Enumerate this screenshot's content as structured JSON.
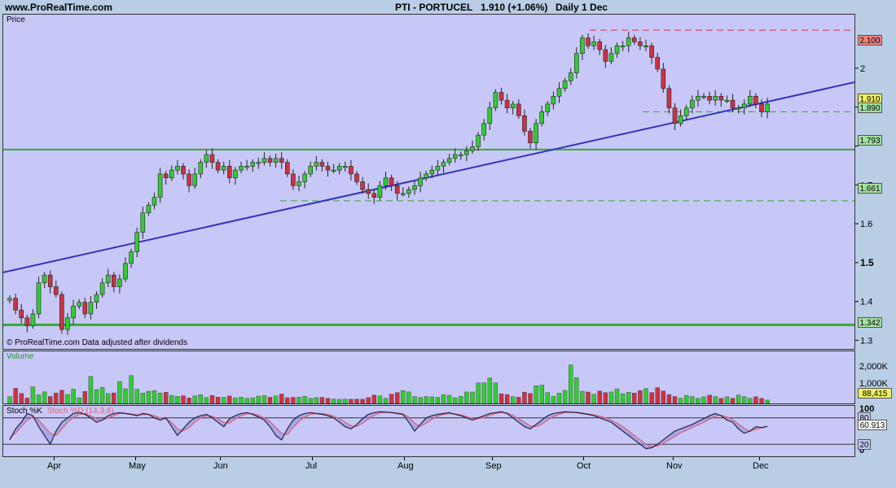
{
  "header": {
    "site": "www.ProRealTime.com",
    "symbol": "PTI - PORTUCEL",
    "quote": "1.910 (+1.06%)",
    "period": "Daily  1 Dec"
  },
  "price_panel": {
    "label": "Price",
    "footer": "© ProRealTime.com  Data adjusted after dividends",
    "tags": [
      {
        "text": "2.100",
        "bg": "#f08080"
      },
      {
        "text": "1.910",
        "bg": "#f0f060"
      },
      {
        "text": "1.890",
        "bg": "#a0e0a0"
      },
      {
        "text": "1.793",
        "bg": "#a0e0a0"
      },
      {
        "text": "1.661",
        "bg": "#a0e0a0"
      },
      {
        "text": "1.342",
        "bg": "#a0e0a0"
      }
    ]
  },
  "volume_panel": {
    "label": "Volume",
    "axis": [
      "2,000K",
      "1,000K"
    ],
    "tag": "88,415"
  },
  "stoch_panel": {
    "label_k": "Stoch %K",
    "label_d": "Stoch %D (14,3,6)",
    "axis_top": "100",
    "axis_bottom": "0",
    "tags": [
      {
        "text": "80"
      },
      {
        "text": "60.913"
      },
      {
        "text": "20"
      }
    ]
  },
  "colors": {
    "up": "#33cc33",
    "down": "#cc3344",
    "trend": "#3333bb",
    "support": "#33aa33",
    "resistance": "#cc3344",
    "stoch_d": "#e06070"
  },
  "chart_data": {
    "type": "candlestick",
    "title": "PTI - PORTUCEL",
    "ylabel": "Price",
    "ylim": [
      1.28,
      2.14
    ],
    "yticks": [
      1.3,
      1.4,
      1.5,
      1.6,
      1.7,
      1.8,
      1.9,
      2.0
    ],
    "ytick_labels": [
      "1.3",
      "1.4",
      "1.5",
      "1.6",
      "1.7",
      "",
      "1.9",
      "2"
    ],
    "months": [
      "Apr",
      "May",
      "Jun",
      "Jul",
      "Aug",
      "Sep",
      "Oct",
      "Nov",
      "Dec"
    ],
    "close_path": [
      1.41,
      1.38,
      1.36,
      1.34,
      1.37,
      1.45,
      1.47,
      1.44,
      1.42,
      1.33,
      1.36,
      1.39,
      1.4,
      1.37,
      1.4,
      1.42,
      1.45,
      1.47,
      1.44,
      1.46,
      1.5,
      1.53,
      1.58,
      1.63,
      1.65,
      1.67,
      1.73,
      1.72,
      1.74,
      1.75,
      1.73,
      1.7,
      1.73,
      1.76,
      1.78,
      1.76,
      1.74,
      1.75,
      1.72,
      1.74,
      1.75,
      1.75,
      1.76,
      1.76,
      1.77,
      1.76,
      1.77,
      1.76,
      1.73,
      1.7,
      1.71,
      1.73,
      1.75,
      1.76,
      1.75,
      1.74,
      1.74,
      1.75,
      1.75,
      1.73,
      1.71,
      1.69,
      1.68,
      1.67,
      1.7,
      1.72,
      1.7,
      1.68,
      1.68,
      1.69,
      1.7,
      1.72,
      1.73,
      1.74,
      1.75,
      1.76,
      1.77,
      1.78,
      1.78,
      1.79,
      1.8,
      1.83,
      1.86,
      1.9,
      1.94,
      1.92,
      1.9,
      1.91,
      1.88,
      1.84,
      1.81,
      1.86,
      1.89,
      1.91,
      1.93,
      1.95,
      1.97,
      1.99,
      2.04,
      2.08,
      2.06,
      2.07,
      2.05,
      2.02,
      2.04,
      2.06,
      2.06,
      2.08,
      2.07,
      2.06,
      2.06,
      2.03,
      2.0,
      1.95,
      1.9,
      1.86,
      1.88,
      1.9,
      1.92,
      1.93,
      1.93,
      1.92,
      1.93,
      1.92,
      1.92,
      1.9,
      1.9,
      1.91,
      1.93,
      1.91,
      1.89,
      1.91
    ],
    "volume_path": [
      400,
      900,
      600,
      300,
      1000,
      500,
      700,
      400,
      600,
      800,
      500,
      900,
      300,
      600,
      1700,
      800,
      1000,
      600,
      500,
      1400,
      700,
      1800,
      900,
      600,
      700,
      800,
      600,
      700,
      500,
      400,
      500,
      300,
      400,
      600,
      300,
      500,
      400,
      300,
      500,
      300,
      400,
      300,
      300,
      400,
      500,
      400,
      300,
      700,
      300,
      400,
      300,
      500,
      300,
      300,
      400,
      300,
      300,
      200,
      300,
      200,
      300,
      200,
      300,
      400,
      600,
      300,
      300,
      800,
      500,
      1000,
      400,
      400,
      300,
      500,
      300,
      400,
      600,
      400,
      300,
      500,
      800,
      600,
      1600,
      1000,
      1800,
      900,
      400,
      600,
      300,
      400,
      800,
      500,
      1300,
      1000,
      500,
      400,
      700,
      800,
      2800,
      1100,
      600,
      700,
      500,
      800,
      600,
      700,
      900,
      500,
      700,
      600,
      800,
      900,
      600,
      1000,
      700,
      500,
      400,
      300,
      500,
      400,
      300,
      400,
      500,
      400,
      300,
      400,
      300,
      500,
      400,
      300,
      400,
      300,
      200
    ],
    "stoch_k_path": [
      30,
      55,
      70,
      90,
      85,
      60,
      40,
      20,
      50,
      70,
      80,
      90,
      92,
      88,
      80,
      70,
      75,
      85,
      90,
      92,
      90,
      88,
      85,
      90,
      88,
      80,
      75,
      80,
      60,
      40,
      55,
      70,
      80,
      85,
      88,
      80,
      70,
      60,
      78,
      85,
      90,
      92,
      88,
      82,
      75,
      60,
      40,
      30,
      55,
      75,
      85,
      90,
      92,
      90,
      88,
      85,
      80,
      70,
      60,
      55,
      65,
      78,
      88,
      92,
      94,
      93,
      92,
      90,
      88,
      70,
      50,
      65,
      80,
      85,
      88,
      90,
      92,
      88,
      85,
      80,
      75,
      80,
      85,
      90,
      92,
      94,
      90,
      80,
      70,
      60,
      55,
      65,
      75,
      85,
      90,
      92,
      94,
      93,
      92,
      90,
      88,
      85,
      80,
      75,
      70,
      60,
      50,
      40,
      30,
      20,
      10,
      12,
      20,
      30,
      40,
      50,
      55,
      60,
      65,
      72,
      78,
      85,
      90,
      85,
      75,
      70,
      55,
      45,
      50,
      60,
      58,
      61
    ],
    "stoch_d_path": [
      35,
      45,
      60,
      75,
      82,
      75,
      60,
      45,
      40,
      55,
      70,
      80,
      88,
      90,
      85,
      78,
      75,
      80,
      85,
      90,
      90,
      89,
      87,
      87,
      88,
      85,
      80,
      78,
      70,
      55,
      50,
      58,
      70,
      80,
      85,
      84,
      78,
      70,
      68,
      78,
      85,
      89,
      90,
      86,
      80,
      72,
      58,
      45,
      42,
      58,
      72,
      82,
      88,
      90,
      90,
      88,
      84,
      78,
      70,
      62,
      60,
      68,
      77,
      86,
      91,
      93,
      93,
      91,
      89,
      82,
      68,
      60,
      68,
      77,
      84,
      88,
      90,
      89,
      87,
      83,
      79,
      78,
      81,
      86,
      90,
      92,
      91,
      86,
      78,
      70,
      62,
      60,
      66,
      75,
      83,
      88,
      92,
      93,
      93,
      91,
      89,
      87,
      84,
      80,
      75,
      68,
      60,
      50,
      40,
      30,
      20,
      15,
      16,
      22,
      30,
      38,
      46,
      52,
      58,
      64,
      70,
      77,
      84,
      86,
      82,
      76,
      66,
      56,
      50,
      54,
      57,
      60
    ]
  }
}
